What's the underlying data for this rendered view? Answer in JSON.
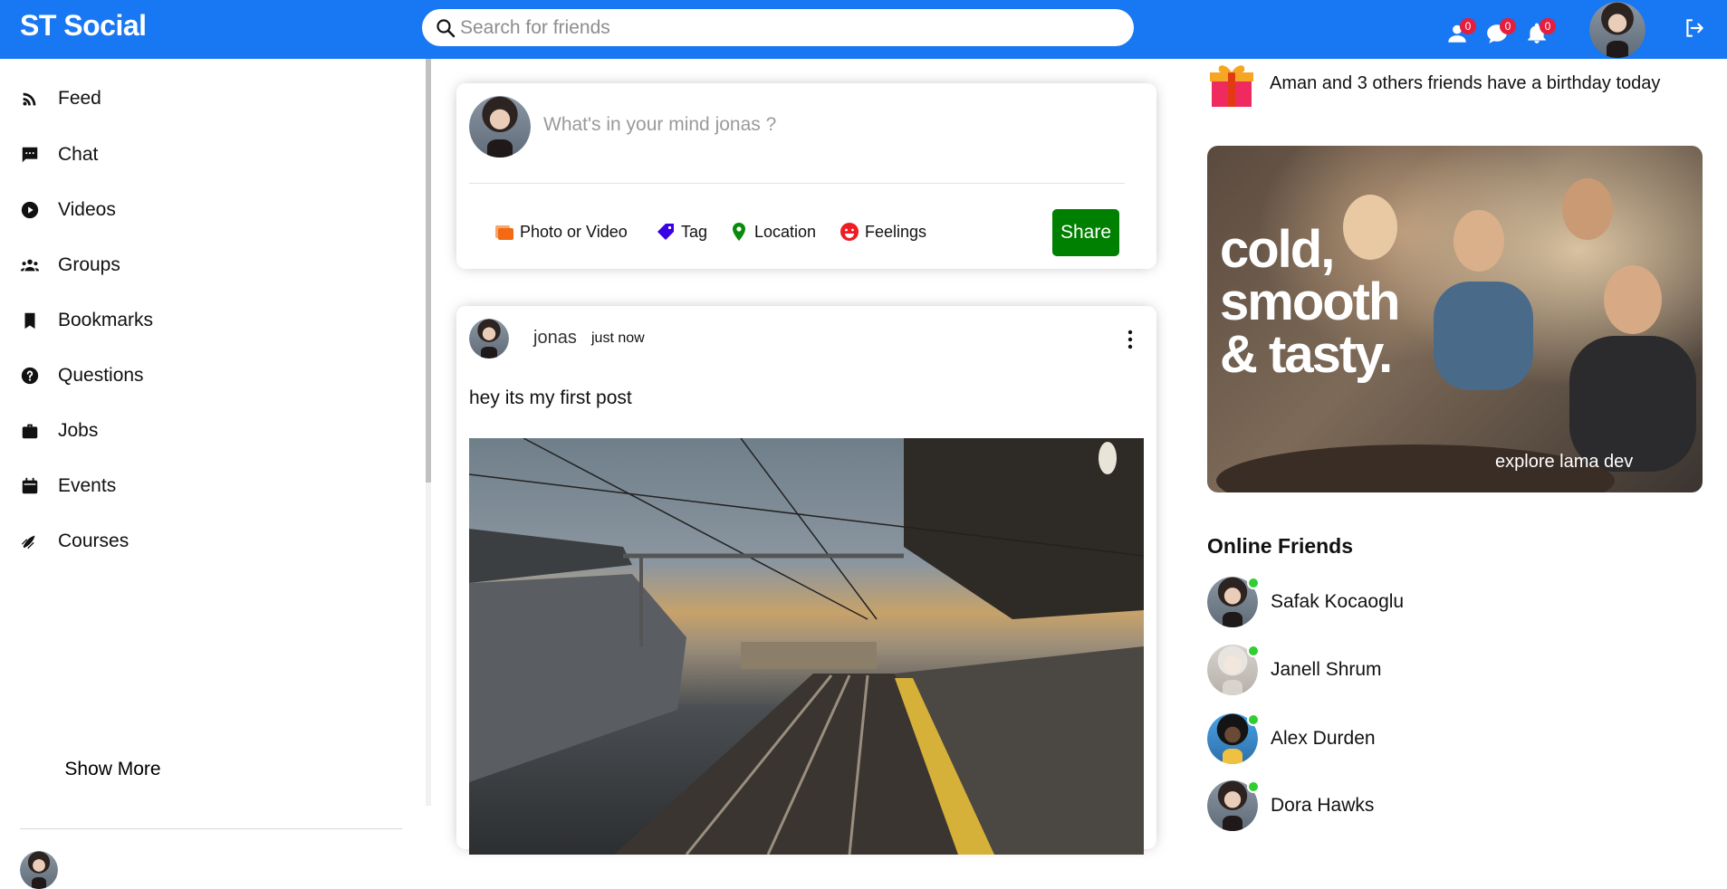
{
  "app": {
    "title": "ST Social"
  },
  "search": {
    "placeholder": "Search for friends"
  },
  "notifications": {
    "friends": "0",
    "messages": "0",
    "alerts": "0"
  },
  "sidebar": {
    "items": [
      {
        "label": "Feed",
        "icon": "rss-icon"
      },
      {
        "label": "Chat",
        "icon": "chat-icon"
      },
      {
        "label": "Videos",
        "icon": "play-circle-icon"
      },
      {
        "label": "Groups",
        "icon": "group-icon"
      },
      {
        "label": "Bookmarks",
        "icon": "bookmark-icon"
      },
      {
        "label": "Questions",
        "icon": "help-circle-icon"
      },
      {
        "label": "Jobs",
        "icon": "briefcase-icon"
      },
      {
        "label": "Events",
        "icon": "calendar-icon"
      },
      {
        "label": "Courses",
        "icon": "school-icon"
      }
    ],
    "show_more": "Show More"
  },
  "share": {
    "placeholder": "What's in your mind jonas ?",
    "options": [
      {
        "label": "Photo or Video",
        "icon": "photo-icon",
        "color": "#f36a13"
      },
      {
        "label": "Tag",
        "icon": "tag-icon",
        "color": "#3a00e6"
      },
      {
        "label": "Location",
        "icon": "location-icon",
        "color": "#0a8a0a"
      },
      {
        "label": "Feelings",
        "icon": "emoji-icon",
        "color": "#ef1c23"
      }
    ],
    "button": "Share"
  },
  "post": {
    "username": "jonas",
    "time": "just now",
    "text": "hey its my first post"
  },
  "rightbar": {
    "birthday_text": "Aman and 3 others friends have a birthday today",
    "ad": {
      "headline": [
        "cold,",
        "smooth",
        "& tasty."
      ],
      "tagline": "explore lama dev"
    },
    "online_title": "Online Friends",
    "friends": [
      {
        "name": "Safak Kocaoglu"
      },
      {
        "name": "Janell Shrum"
      },
      {
        "name": "Alex Durden"
      },
      {
        "name": "Dora Hawks"
      }
    ]
  },
  "colors": {
    "topbar": "#1877f2",
    "share_button": "#008000",
    "badge": "#e41e3f",
    "online": "#32cd32"
  }
}
